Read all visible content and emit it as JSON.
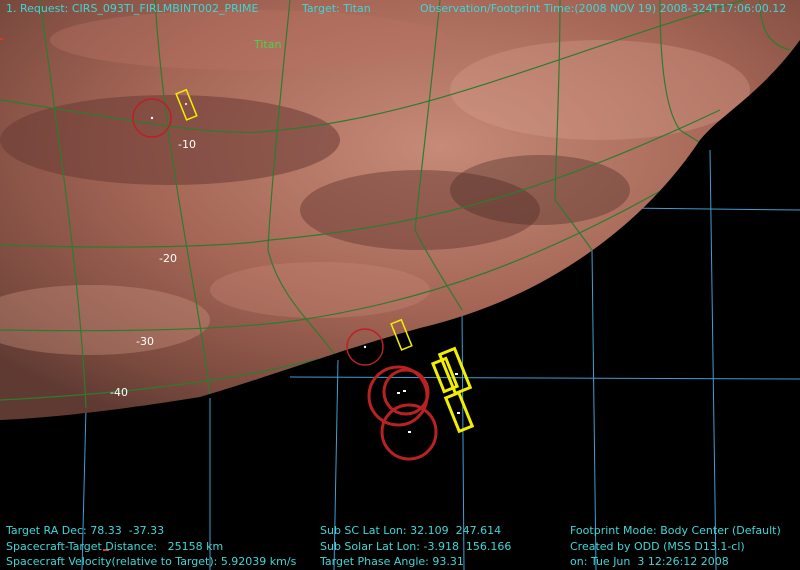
{
  "header": {
    "request": "1. Request: CIRS_093TI_FIRLMBINT002_PRIME",
    "target": "Target: Titan",
    "observation_time": "Observation/Footprint Time:(2008 NOV 19) 2008-324T17:06:00.12"
  },
  "body_label": "Titan",
  "latitude_labels": [
    "-10",
    "-20",
    "-30",
    "-40"
  ],
  "footer": {
    "left": [
      "Target RA Dec: 78.33  -37.33",
      "Spacecraft-Target Distance:   25158 km",
      "Spacecraft Velocity(relative to Target): 5.92039 km/s"
    ],
    "middle": [
      "Sub SC Lat Lon: 32.109  247.614",
      "Sub Solar Lat Lon: -3.918  156.166",
      "Target Phase Angle: 93.31"
    ],
    "right": [
      "Footprint Mode: Body Center (Default)",
      "Created by ODD (MSS D13.1-cl)",
      "on: Tue Jun  3 12:26:12 2008"
    ]
  },
  "colors": {
    "hud_text": "#3fd6d6",
    "body_label": "#4cd14c",
    "grid_sky": "#3fa9e0",
    "grid_body": "#2f7a2f",
    "footprint_circle": "#b82222",
    "footprint_box": "#f2ee00"
  }
}
